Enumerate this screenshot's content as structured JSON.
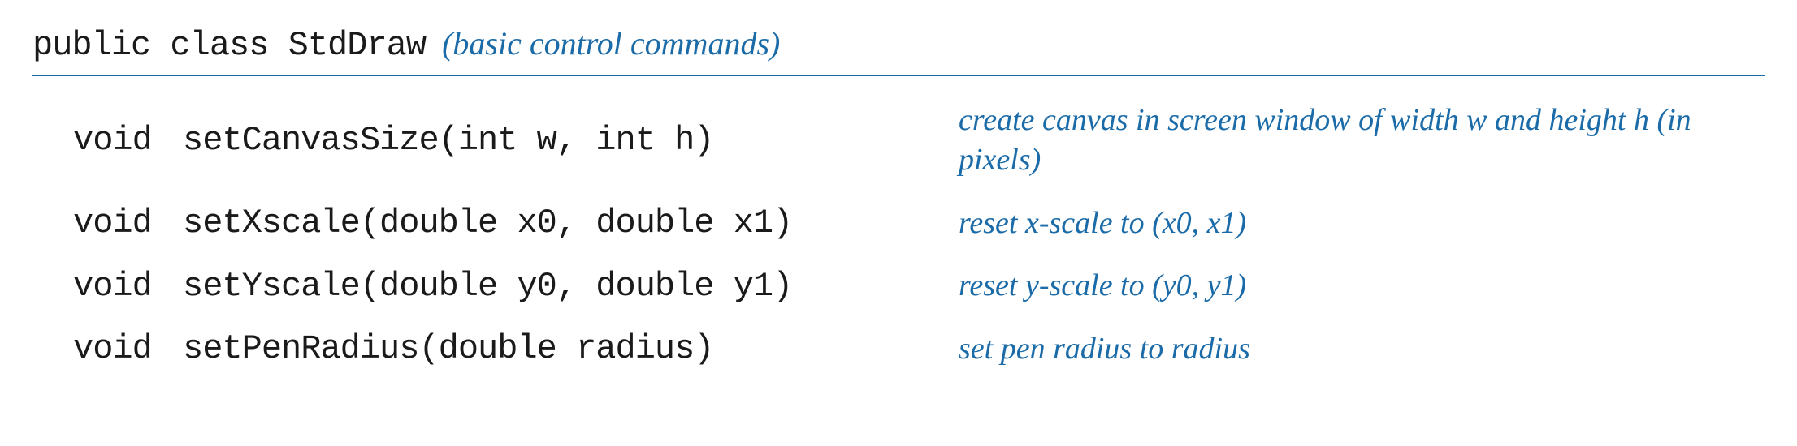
{
  "header": {
    "class_decl": "public class StdDraw",
    "subtitle": "(basic control commands)"
  },
  "methods": [
    {
      "return": "void",
      "signature": "setCanvasSize(int w, int h)",
      "description": "create canvas in screen window of width w and height h (in pixels)"
    },
    {
      "return": "void",
      "signature": "setXscale(double x0, double x1)",
      "description": "reset x-scale to (x0, x1)"
    },
    {
      "return": "void",
      "signature": "setYscale(double y0, double y1)",
      "description": "reset y-scale to (y0, y1)"
    },
    {
      "return": "void",
      "signature": "setPenRadius(double radius)",
      "description": "set pen radius to radius"
    }
  ]
}
